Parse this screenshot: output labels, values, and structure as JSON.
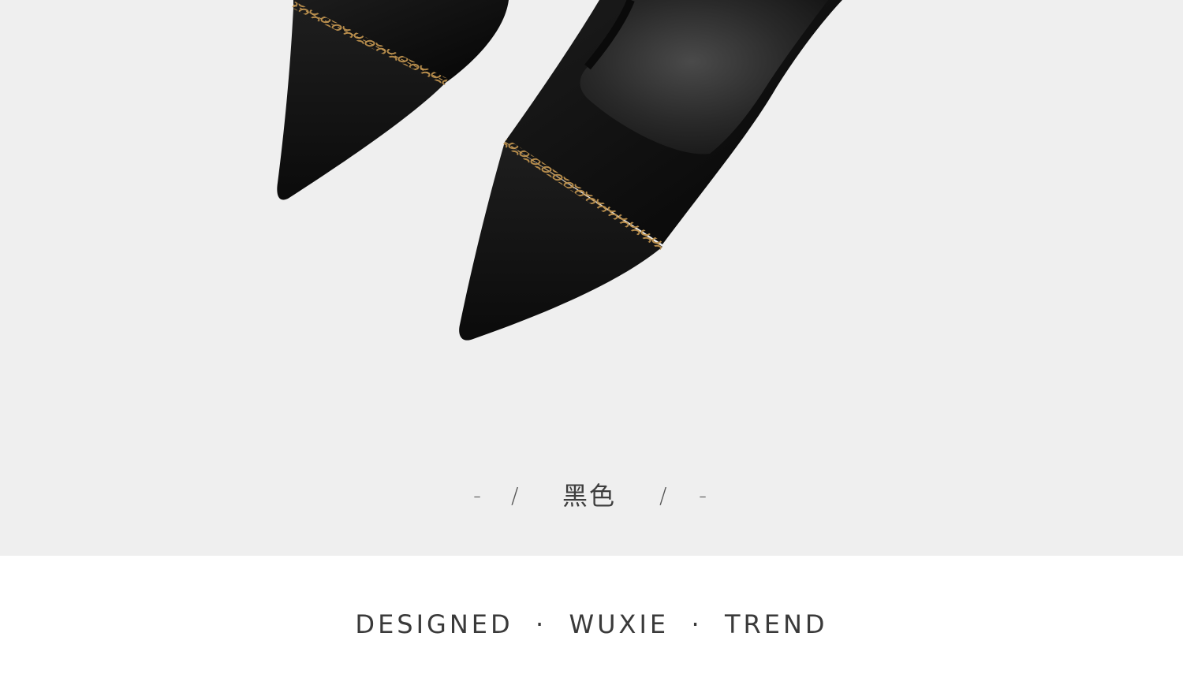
{
  "product_image": {
    "subject": "shoe-photo",
    "background_color": "#efefef"
  },
  "color_caption": {
    "left_dash": "-",
    "left_slash": "/",
    "name": "黑色",
    "right_slash": "/",
    "right_dash": "-"
  },
  "footer": {
    "tagline": "DESIGNED  ·  WUXIE  ·  TREND",
    "background_color": "#ffffff"
  }
}
